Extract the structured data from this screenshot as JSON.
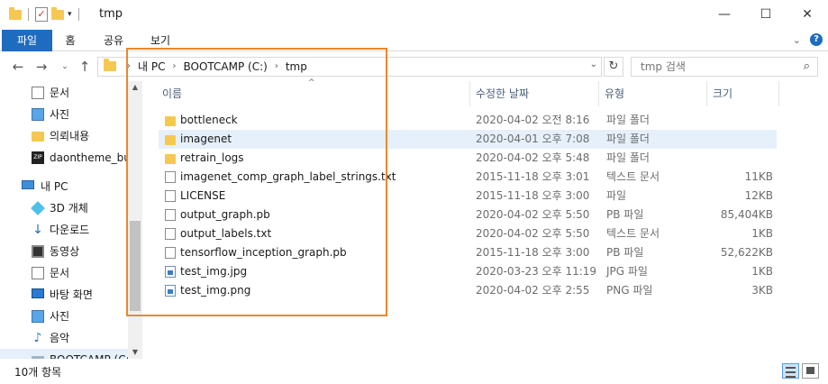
{
  "window": {
    "title": "tmp"
  },
  "ribbon": {
    "tabs": [
      "파일",
      "홈",
      "공유",
      "보기"
    ]
  },
  "address": {
    "crumbs": [
      "내 PC",
      "BOOTCAMP (C:)",
      "tmp"
    ]
  },
  "search": {
    "placeholder": "tmp 검색"
  },
  "sidebar": {
    "items": [
      {
        "label": "문서",
        "icon": "document-icon"
      },
      {
        "label": "사진",
        "icon": "picture-icon"
      },
      {
        "label": "의뢰내용",
        "icon": "folder-icon"
      },
      {
        "label": "daontheme_bus",
        "icon": "zip-icon"
      },
      {
        "label": "내 PC",
        "icon": "pc-icon"
      },
      {
        "label": "3D 개체",
        "icon": "3d-objects-icon"
      },
      {
        "label": "다운로드",
        "icon": "download-icon"
      },
      {
        "label": "동영상",
        "icon": "video-icon"
      },
      {
        "label": "문서",
        "icon": "document-icon"
      },
      {
        "label": "바탕 화면",
        "icon": "desktop-icon"
      },
      {
        "label": "사진",
        "icon": "picture-icon"
      },
      {
        "label": "음악",
        "icon": "music-icon"
      },
      {
        "label": "BOOTCAMP (C:)",
        "icon": "drive-icon"
      }
    ]
  },
  "columns": {
    "name": "이름",
    "date": "수정한 날짜",
    "type": "유형",
    "size": "크기"
  },
  "files": [
    {
      "name": "bottleneck",
      "date": "2020-04-02 오전 8:16",
      "type": "파일 폴더",
      "size": "",
      "kind": "folder"
    },
    {
      "name": "imagenet",
      "date": "2020-04-01 오후 7:08",
      "type": "파일 폴더",
      "size": "",
      "kind": "folder"
    },
    {
      "name": "retrain_logs",
      "date": "2020-04-02 오후 5:48",
      "type": "파일 폴더",
      "size": "",
      "kind": "folder"
    },
    {
      "name": "imagenet_comp_graph_label_strings.txt",
      "date": "2015-11-18 오후 3:01",
      "type": "텍스트 문서",
      "size": "11KB",
      "kind": "file"
    },
    {
      "name": "LICENSE",
      "date": "2015-11-18 오후 3:00",
      "type": "파일",
      "size": "12KB",
      "kind": "file"
    },
    {
      "name": "output_graph.pb",
      "date": "2020-04-02 오후 5:50",
      "type": "PB 파일",
      "size": "85,404KB",
      "kind": "file"
    },
    {
      "name": "output_labels.txt",
      "date": "2020-04-02 오후 5:50",
      "type": "텍스트 문서",
      "size": "1KB",
      "kind": "file"
    },
    {
      "name": "tensorflow_inception_graph.pb",
      "date": "2015-11-18 오후 3:00",
      "type": "PB 파일",
      "size": "52,622KB",
      "kind": "file"
    },
    {
      "name": "test_img.jpg",
      "date": "2020-03-23 오후 11:19",
      "type": "JPG 파일",
      "size": "1KB",
      "kind": "image"
    },
    {
      "name": "test_img.png",
      "date": "2020-04-02 오후 2:55",
      "type": "PNG 파일",
      "size": "3KB",
      "kind": "image"
    }
  ],
  "status": {
    "count": "10개 항목"
  },
  "colors": {
    "accent": "#1e6cbf",
    "highlight_box": "#e8892e",
    "selection": "#e5f0fb",
    "folder": "#f6c84f"
  }
}
